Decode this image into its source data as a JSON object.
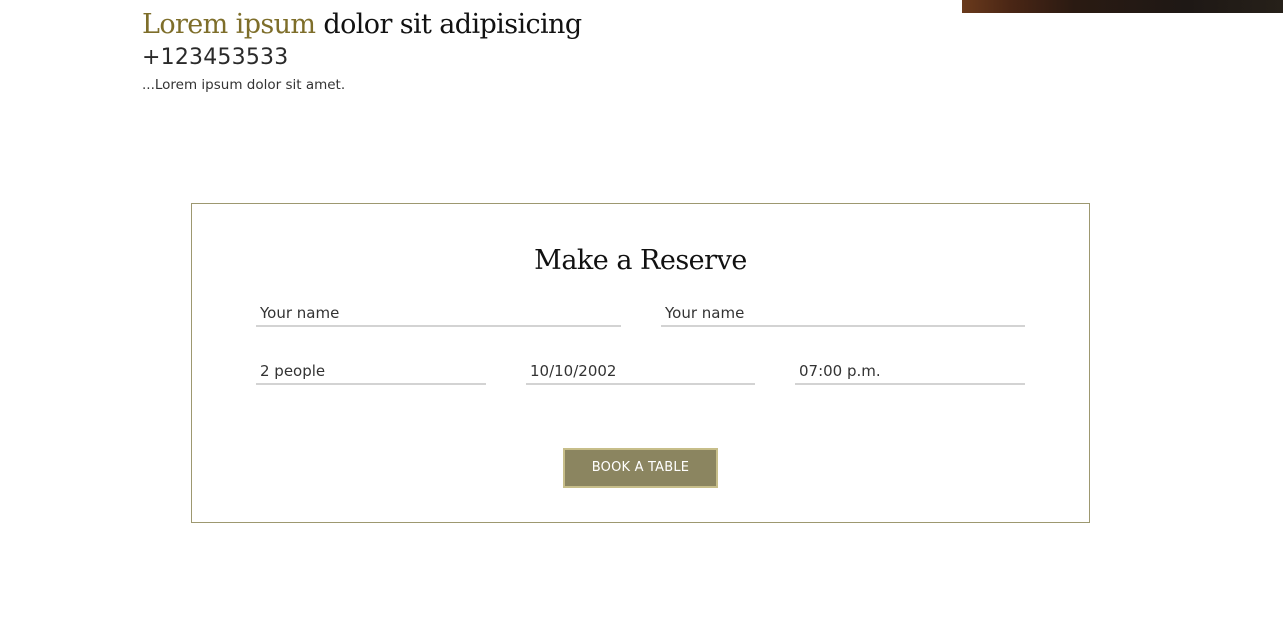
{
  "header": {
    "title_accent": "Lorem ipsum",
    "title_rest": " dolor sit adipisicing",
    "phone": "+123453533",
    "tagline": "...Lorem ipsum dolor sit amet."
  },
  "reserve": {
    "title": "Make a Reserve",
    "fields": {
      "name_first": {
        "placeholder": "Your name",
        "value": ""
      },
      "name_second": {
        "placeholder": "Your name",
        "value": ""
      },
      "people": {
        "placeholder": "2 people",
        "value": ""
      },
      "date": {
        "placeholder": "10/10/2002",
        "value": ""
      },
      "time": {
        "placeholder": "07:00 p.m.",
        "value": ""
      }
    },
    "submit_label": "BOOK A TABLE"
  },
  "colors": {
    "accent": "#7e6e2a",
    "button": "#8b8560",
    "border": "#9d9870"
  }
}
